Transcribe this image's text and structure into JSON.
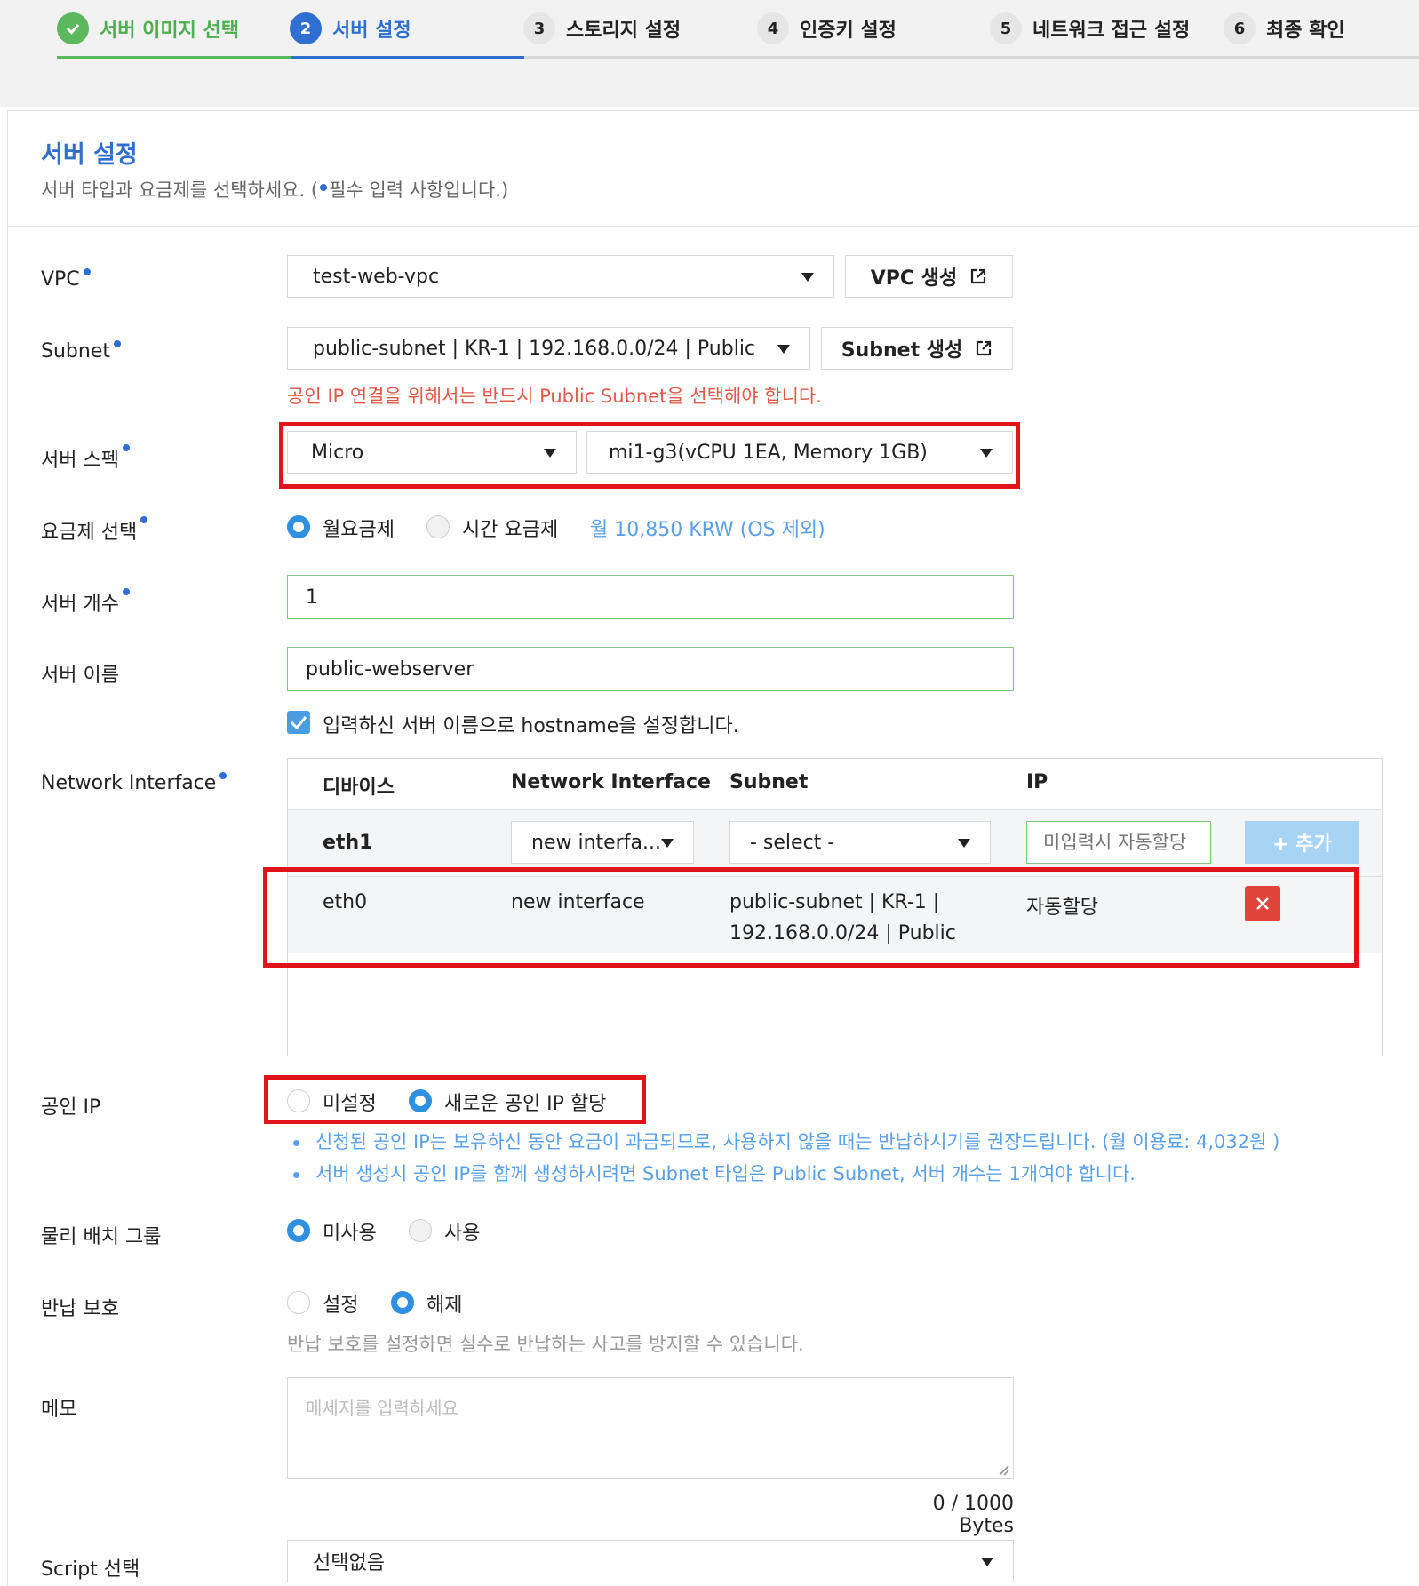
{
  "stepper": {
    "steps": [
      {
        "num": "✓",
        "label": "서버 이미지 선택"
      },
      {
        "num": "2",
        "label": "서버 설정"
      },
      {
        "num": "3",
        "label": "스토리지 설정"
      },
      {
        "num": "4",
        "label": "인증키 설정"
      },
      {
        "num": "5",
        "label": "네트워크 접근 설정"
      },
      {
        "num": "6",
        "label": "최종 확인"
      }
    ]
  },
  "header": {
    "title": "서버 설정",
    "subtitle_before": "서버 타입과 요금제를 선택하세요. (",
    "subtitle_after": "필수 입력 사항입니다.)"
  },
  "form": {
    "vpc": {
      "label": "VPC",
      "value": "test-web-vpc",
      "button": "VPC 생성"
    },
    "subnet": {
      "label": "Subnet",
      "value": "public-subnet | KR-1 | 192.168.0.0/24 | Public",
      "button": "Subnet 생성",
      "warning": "공인 IP 연결을 위해서는 반드시 Public Subnet을 선택해야 합니다."
    },
    "spec": {
      "label": "서버 스펙",
      "type": "Micro",
      "size": "mi1-g3(vCPU 1EA, Memory 1GB)"
    },
    "billing": {
      "label": "요금제 선택",
      "monthly": "월요금제",
      "hourly": "시간 요금제",
      "price": "월 10,850 KRW (OS 제외)",
      "selected": "monthly"
    },
    "count": {
      "label": "서버 개수",
      "value": "1"
    },
    "name": {
      "label": "서버 이름",
      "value": "public-webserver",
      "hostname_check": "입력하신 서버 이름으로 hostname을 설정합니다.",
      "checked": true
    },
    "nic": {
      "label": "Network Interface",
      "headers": [
        "디바이스",
        "Network Interface",
        "Subnet",
        "IP"
      ],
      "new_row": {
        "device": "eth1",
        "interface": "new interfa...",
        "subnet": "- select -",
        "ip_placeholder": "미입력시 자동할당",
        "add": "+ 추가"
      },
      "rows": [
        {
          "device": "eth0",
          "interface": "new interface",
          "subnet_line1": "public-subnet | KR-1 |",
          "subnet_line2": "192.168.0.0/24 | Public",
          "ip": "자동할당"
        }
      ]
    },
    "public_ip": {
      "label": "공인 IP",
      "opt_none": "미설정",
      "opt_new": "새로운 공인 IP 할당",
      "selected": "new",
      "notes": [
        "신청된 공인 IP는 보유하신 동안 요금이 과금되므로, 사용하지 않을 때는 반납하시기를 권장드립니다. (월 이용료: 4,032원 )",
        "서버 생성시 공인 IP를 함께 생성하시려면 Subnet 타입은 Public Subnet, 서버 개수는 1개여야 합니다."
      ]
    },
    "placement": {
      "label": "물리 배치 그룹",
      "opt_unused": "미사용",
      "opt_used": "사용",
      "selected": "unused"
    },
    "protection": {
      "label": "반납 보호",
      "opt_on": "설정",
      "opt_off": "해제",
      "selected": "off",
      "hint": "반납 보호를 설정하면 실수로 반납하는 사고를 방지할 수 있습니다."
    },
    "memo": {
      "label": "메모",
      "placeholder": "메세지를 입력하세요",
      "counter": "0 / 1000 Bytes"
    },
    "script": {
      "label": "Script 선택",
      "value": "선택없음"
    }
  },
  "colors": {
    "accent": "#2f6fd1",
    "done": "#5cb85c",
    "warning": "#e05a4a",
    "highlight": "#e0141b",
    "note": "#5aa0e6"
  }
}
